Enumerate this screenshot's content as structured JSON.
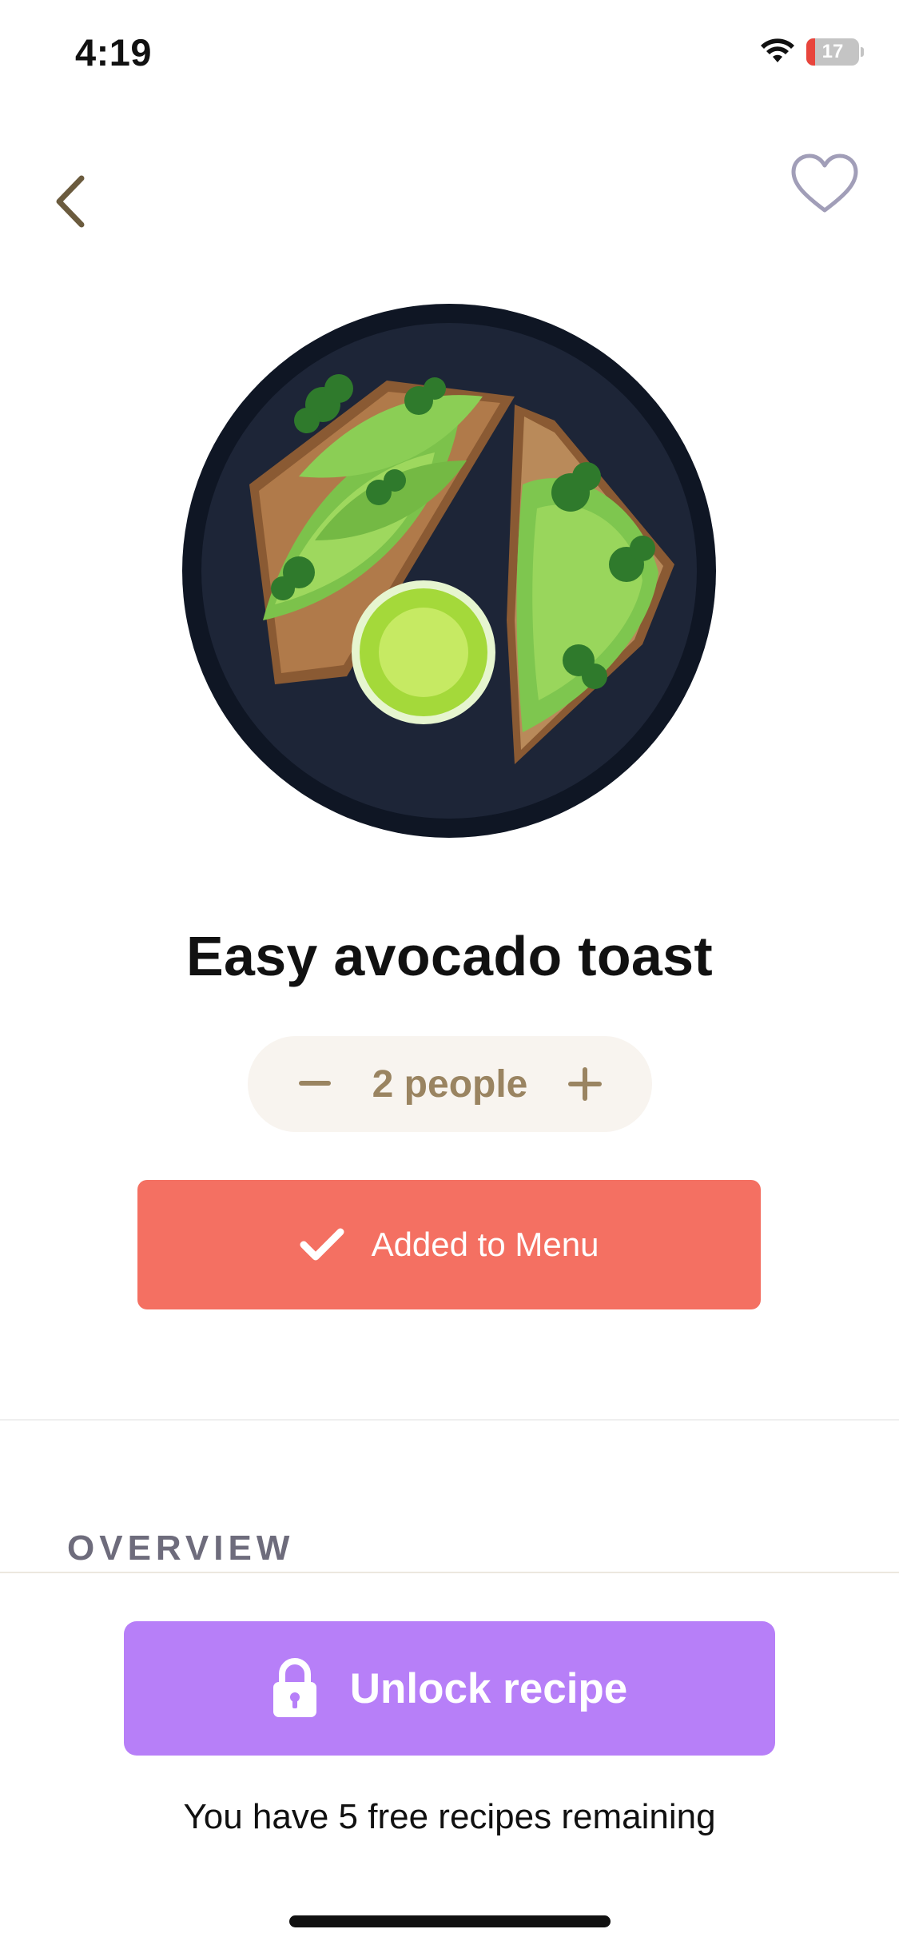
{
  "status_bar": {
    "time": "4:19",
    "battery": "17",
    "battery_level": 0.17,
    "icons": [
      "wifi-icon",
      "battery-icon"
    ]
  },
  "nav": {
    "back_icon": "chevron-left-icon",
    "favorite_icon": "heart-outline-icon"
  },
  "recipe": {
    "title": "Easy avocado toast",
    "image": "avocado-toast-plate"
  },
  "servings": {
    "label": "2 people",
    "decrement_icon": "minus-icon",
    "increment_icon": "plus-icon"
  },
  "menu_button": {
    "label": "Added to Menu",
    "icon": "checkmark-icon",
    "color": "#f47062"
  },
  "section": {
    "overview_label": "OVERVIEW"
  },
  "unlock": {
    "label": "Unlock recipe",
    "icon": "lock-icon",
    "color": "#b77ff8",
    "remaining_text": "You have 5 free recipes remaining"
  },
  "colors": {
    "accent_gold": "#9a8461",
    "stepper_bg": "#f8f4ef",
    "overview_text": "#6e6c7c"
  }
}
